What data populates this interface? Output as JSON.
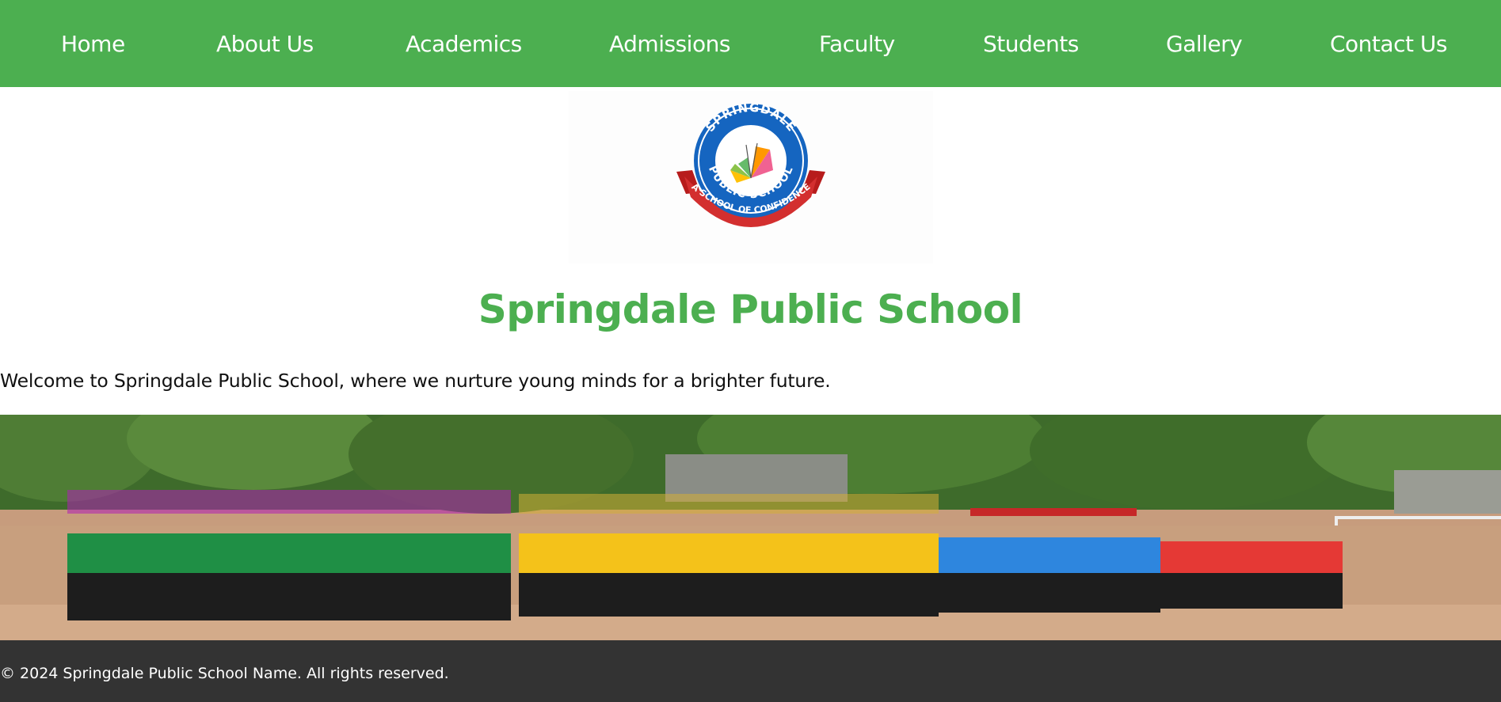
{
  "nav": {
    "items": [
      {
        "label": "Home"
      },
      {
        "label": "About Us"
      },
      {
        "label": "Academics"
      },
      {
        "label": "Admissions"
      },
      {
        "label": "Faculty"
      },
      {
        "label": "Students"
      },
      {
        "label": "Gallery"
      },
      {
        "label": "Contact Us"
      }
    ]
  },
  "logo": {
    "top_text": "SPRINGDALE",
    "bottom_text": "PUBLIC SCHOOL",
    "ribbon_text": "A SCHOOL OF CONFIDENCE"
  },
  "header": {
    "title": "Springdale Public School"
  },
  "intro": {
    "welcome": "Welcome to Springdale Public School, where we nurture young minds for a brighter future."
  },
  "hero": {
    "alt": "Students performing a drill on the school ground"
  },
  "footer": {
    "copyright": "© 2024 Springdale Public School Name. All rights reserved."
  },
  "colors": {
    "nav_bg": "#4caf50",
    "title": "#4caf50",
    "footer_bg": "#333333",
    "logo_blue": "#1565c0",
    "logo_red": "#d32f2f"
  }
}
